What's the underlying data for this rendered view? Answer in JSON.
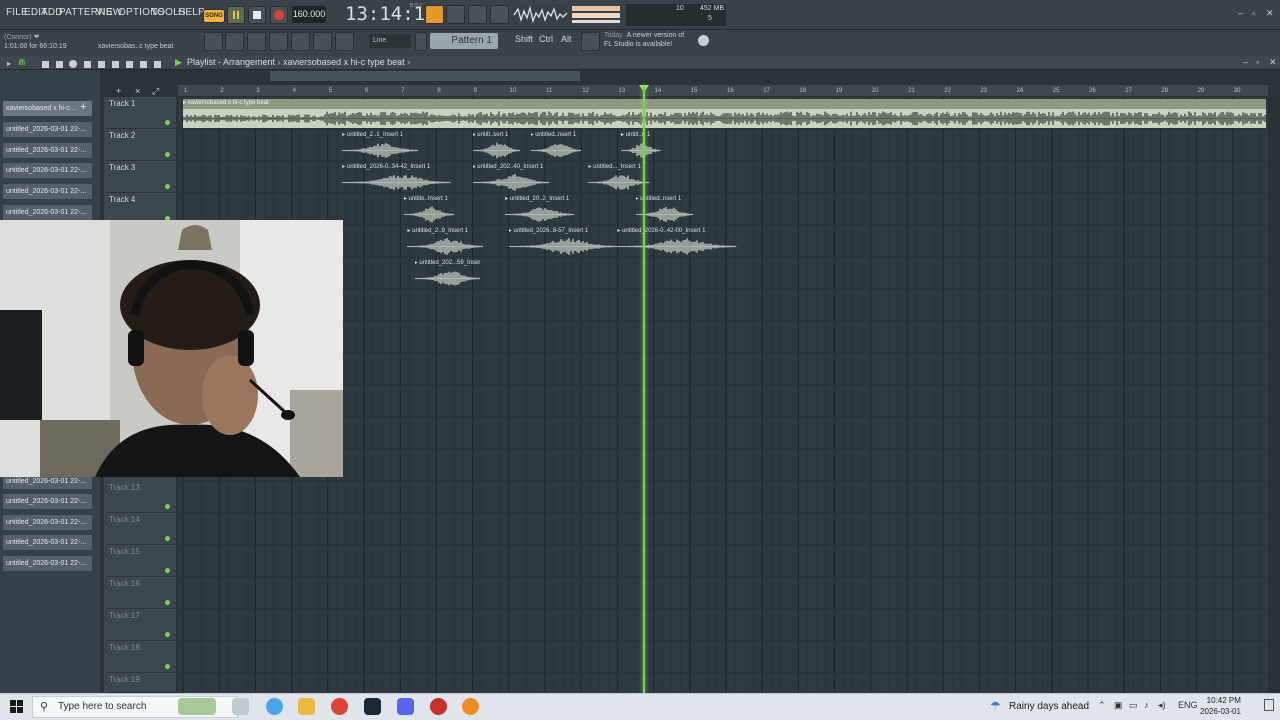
{
  "menu": [
    "FILE",
    "EDIT",
    "ADD",
    "PATTERNS",
    "VIEW",
    "OPTIONS",
    "TOOLS",
    "HELP"
  ],
  "hint": {
    "line1": "(Connor) ❤",
    "line2": "1:01:00 for 66:10:19",
    "project": "xaviersobas..c type beat"
  },
  "transport": {
    "mode": "SONG",
    "tempo": "160.000",
    "time": "13:14:12",
    "time_unit": "B:S:T"
  },
  "cpu": {
    "value": "10",
    "memory": "452 MB",
    "poly": "5"
  },
  "toolbar2": {
    "snap": "Line",
    "pattern": "Pattern 1",
    "shift": "Shift",
    "ctrl": "Ctrl",
    "alt": "Alt"
  },
  "news": {
    "today": "Today",
    "line1": "A newer version of",
    "line2": "FL Studio is available!"
  },
  "playlist": {
    "title": "Playlist - Arrangement",
    "song": "xaviersobased x hi-c type beat"
  },
  "picker": [
    {
      "label": "xaviersobased x hi-c...",
      "selected": true
    },
    {
      "label": "untitled_2026-03-01 22-..."
    },
    {
      "label": "untitled_2026-03-01 22-..."
    },
    {
      "label": "untitled_2026-03-01 22-..."
    },
    {
      "label": "untitled_2026-03-01 22-..."
    },
    {
      "label": "untitled_2026-03-01 22-..."
    },
    {
      "label": "untitled_2026-03-01 22-..."
    },
    {
      "label": "untitled_2026-03-01 22-..."
    },
    {
      "label": "untitled_2026-03-01 22-..."
    },
    {
      "label": "untitled_2026-03-01 22-..."
    },
    {
      "label": "untitled_2026-03-01 22-..."
    }
  ],
  "tracks": [
    {
      "label": "Track 1"
    },
    {
      "label": "Track 2"
    },
    {
      "label": "Track 3"
    },
    {
      "label": "Track 4"
    },
    {
      "label": "Track 13"
    },
    {
      "label": "Track 14"
    },
    {
      "label": "Track 15"
    },
    {
      "label": "Track 16"
    },
    {
      "label": "Track 17"
    },
    {
      "label": "Track 18"
    },
    {
      "label": "Track 19"
    }
  ],
  "ruler": [
    "1",
    "2",
    "3",
    "4",
    "5",
    "6",
    "7",
    "8",
    "9",
    "10",
    "11",
    "12",
    "13",
    "14",
    "15",
    "16",
    "17",
    "18",
    "19",
    "20",
    "21",
    "22",
    "23",
    "24",
    "25",
    "26",
    "27",
    "28",
    "29",
    "30"
  ],
  "clips": [
    {
      "label": "xaviersobased x hi-c type beat",
      "bar_start": 1,
      "bar_end": 31,
      "track": 1
    },
    {
      "label": "untitled_2..1_Insert 1",
      "bar_start": 5.4,
      "bar_end": 7.5,
      "track": 2
    },
    {
      "label": "untitl..sert 1",
      "bar_start": 9.0,
      "bar_end": 10.3,
      "track": 2
    },
    {
      "label": "untitled..nsert 1",
      "bar_start": 10.6,
      "bar_end": 12.0,
      "track": 2
    },
    {
      "label": "untitl..rt 1",
      "bar_start": 13.1,
      "bar_end": 14.2,
      "track": 2
    },
    {
      "label": "untitled_2026-0..34-42_Insert 1",
      "bar_start": 5.4,
      "bar_end": 8.4,
      "track": 3
    },
    {
      "label": "untitled_202..40_Insert 1",
      "bar_start": 9.0,
      "bar_end": 11.1,
      "track": 3
    },
    {
      "label": "untitled..._Insert 1",
      "bar_start": 12.2,
      "bar_end": 13.9,
      "track": 3
    },
    {
      "label": "untitle..Insert 1",
      "bar_start": 7.1,
      "bar_end": 8.5,
      "track": 4
    },
    {
      "label": "untitled_20..2_Insert 1",
      "bar_start": 9.9,
      "bar_end": 11.8,
      "track": 4
    },
    {
      "label": "untitled..nsert 1",
      "bar_start": 13.5,
      "bar_end": 15.1,
      "track": 4
    },
    {
      "label": "untitled_2..9_Insert 1",
      "bar_start": 7.2,
      "bar_end": 9.3,
      "track": 5
    },
    {
      "label": "untitled_2026..8-57_Insert 1",
      "bar_start": 10.0,
      "bar_end": 13.0,
      "track": 5
    },
    {
      "label": "untitled_2026-0..42-00_Insert 1",
      "bar_start": 13.0,
      "bar_end": 16.3,
      "track": 5
    },
    {
      "label": "untitled_202...59_Insert 1",
      "bar_start": 7.4,
      "bar_end": 9.2,
      "track": 6
    }
  ],
  "playhead_bar": 13.7,
  "taskbar": {
    "search": "Type here to search",
    "weather": "Rainy days ahead",
    "lang": "ENG",
    "time": "10:42 PM",
    "date": "2026-03-01"
  },
  "colors": {
    "accent": "#f4b13f",
    "playhead": "#7ed24a",
    "clip": "#c9d3bf",
    "wave": "#dce4d6"
  }
}
